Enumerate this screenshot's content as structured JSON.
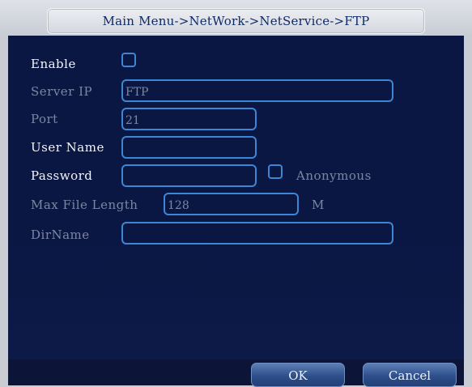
{
  "window": {
    "title": "Main Menu->NetWork->NetService->FTP"
  },
  "form": {
    "enable_label": "Enable",
    "server_ip_label": "Server IP",
    "server_ip_value": "FTP",
    "port_label": "Port",
    "port_value": "21",
    "username_label": "User Name",
    "username_value": "",
    "password_label": "Password",
    "password_value": "",
    "anonymous_label": "Anonymous",
    "max_file_length_label": "Max File Length",
    "max_file_length_value": "128",
    "max_file_length_unit": "M",
    "dirname_label": "DirName",
    "dirname_value": ""
  },
  "buttons": {
    "ok_label": "OK",
    "cancel_label": "Cancel"
  },
  "colors": {
    "panel": "#0b1743",
    "accent": "#3d86d6",
    "enabled_text": "#f3f5fb",
    "disabled_text": "#7c86a3",
    "title": "#0e2a66"
  }
}
